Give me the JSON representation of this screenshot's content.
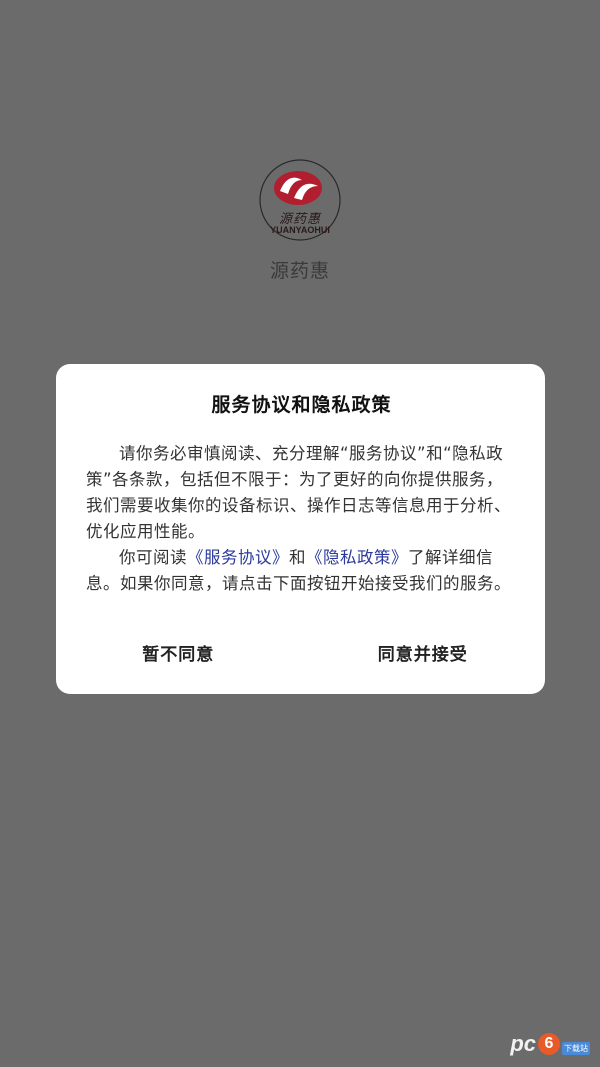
{
  "splash": {
    "logo_cn": "源药惠",
    "logo_en": "YUANYAOHUI",
    "app_name": "源药惠"
  },
  "dialog": {
    "title": "服务协议和隐私政策",
    "para1": "请你务必审慎阅读、充分理解“服务协议”和“隐私政策”各条款，包括但不限于：为了更好的向你提供服务，我们需要收集你的设备标识、操作日志等信息用于分析、优化应用性能。",
    "para2_prefix": "你可阅读",
    "link_service": "《服务协议》",
    "para2_and": "和",
    "link_privacy": "《隐私政策》",
    "para2_suffix": "了解详细信息。如果你同意，请点击下面按钮开始接受我们的服务。",
    "decline_label": "暂不同意",
    "accept_label": "同意并接受"
  },
  "watermark": {
    "pc": "pc",
    "six": "6",
    "tag": "下载站"
  },
  "colors": {
    "overlay": "#6b6b6b",
    "link": "#2b3a9c",
    "logo_red": "#b01e2f"
  }
}
